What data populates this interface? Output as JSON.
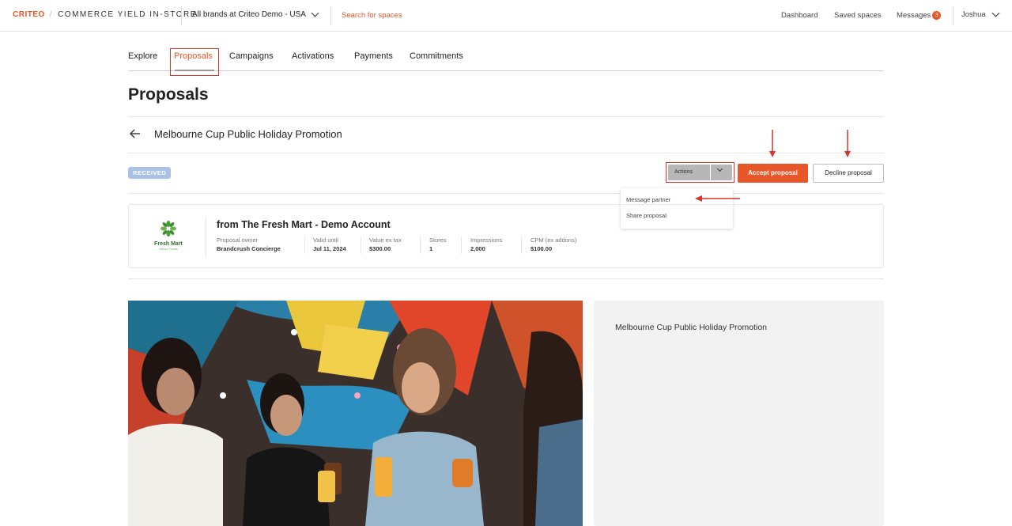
{
  "header": {
    "brand": "CRITEO",
    "product": "COMMERCE YIELD IN-STORE",
    "brand_selector": "All brands at Criteo Demo - USA",
    "search_link": "Search for spaces",
    "nav": {
      "dashboard": "Dashboard",
      "saved_spaces": "Saved spaces",
      "messages": "Messages",
      "messages_count": "3"
    },
    "user_name": "Joshua"
  },
  "tabs": [
    {
      "label": "Explore"
    },
    {
      "label": "Proposals"
    },
    {
      "label": "Campaigns"
    },
    {
      "label": "Activations"
    },
    {
      "label": "Payments"
    },
    {
      "label": "Commitments"
    }
  ],
  "page_title": "Proposals",
  "proposal": {
    "name": "Melbourne Cup Public Holiday Promotion",
    "status": "RECEIVED"
  },
  "actions": {
    "actions_label": "Actions",
    "accept_label": "Accept proposal",
    "decline_label": "Decline proposal",
    "menu": [
      "Message partner",
      "Share proposal"
    ]
  },
  "card": {
    "partner_logo_name": "Fresh Mart",
    "partner_logo_sub": "Whole Foods",
    "from_title": "from The Fresh Mart - Demo Account",
    "meta": [
      {
        "label": "Proposal owner",
        "value": "Brandcrush Concierge"
      },
      {
        "label": "Valid until",
        "value": "Jul 11, 2024"
      },
      {
        "label": "Value ex tax",
        "value": "$300.00"
      },
      {
        "label": "Stores",
        "value": "1"
      },
      {
        "label": "Impressions",
        "value": "2,000"
      },
      {
        "label": "CPM (ex addons)",
        "value": "$100.00"
      }
    ]
  },
  "side_panel_title": "Melbourne Cup Public Holiday Promotion",
  "colors": {
    "accent": "#e8572a",
    "status_badge": "#a9c2e3",
    "annotation": "#d9342b"
  }
}
